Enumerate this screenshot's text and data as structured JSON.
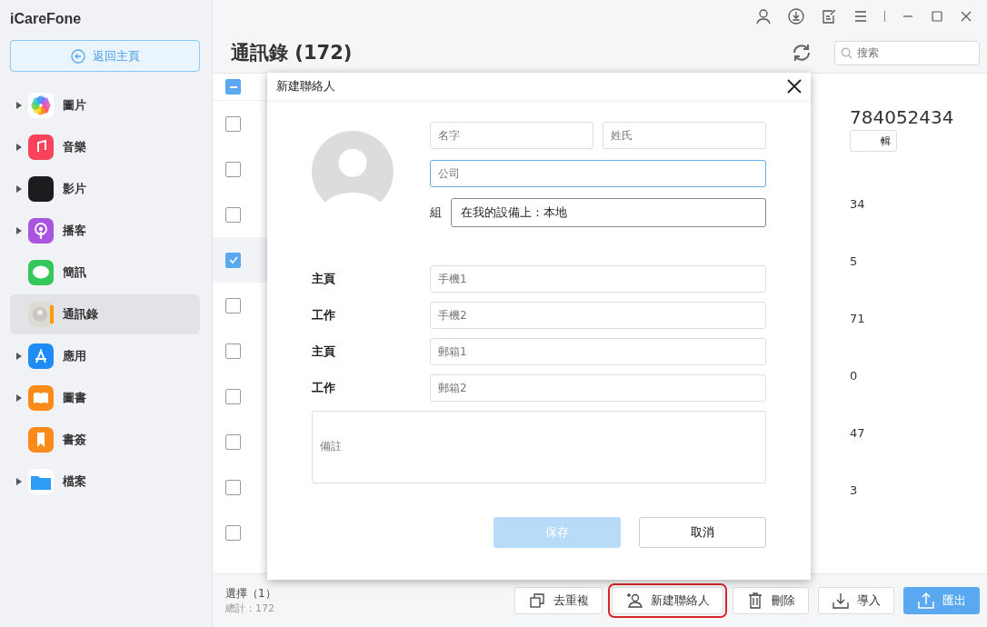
{
  "app": {
    "name": "iCareFone",
    "back_button": "返回主頁"
  },
  "sidebar": {
    "items": [
      {
        "label": "圖片",
        "kind": "photos",
        "expandable": true,
        "selected": false
      },
      {
        "label": "音樂",
        "kind": "music",
        "expandable": true,
        "selected": false
      },
      {
        "label": "影片",
        "kind": "tv",
        "expandable": true,
        "selected": false
      },
      {
        "label": "播客",
        "kind": "podcast",
        "expandable": true,
        "selected": false
      },
      {
        "label": "簡訊",
        "kind": "messages",
        "expandable": false,
        "selected": false
      },
      {
        "label": "通訊錄",
        "kind": "contacts",
        "expandable": false,
        "selected": true
      },
      {
        "label": "應用",
        "kind": "apps",
        "expandable": true,
        "selected": false
      },
      {
        "label": "圖書",
        "kind": "books",
        "expandable": true,
        "selected": false
      },
      {
        "label": "書簽",
        "kind": "bookmarks",
        "expandable": false,
        "selected": false
      },
      {
        "label": "檔案",
        "kind": "files",
        "expandable": true,
        "selected": false
      }
    ]
  },
  "header": {
    "title": "通訊錄 (172)",
    "search": {
      "placeholder": "搜索"
    }
  },
  "list": {
    "select_all_partial": true,
    "rows": [
      {
        "checked": false
      },
      {
        "checked": false
      },
      {
        "checked": false
      },
      {
        "checked": true
      },
      {
        "checked": false
      },
      {
        "checked": false
      },
      {
        "checked": false
      },
      {
        "checked": false
      },
      {
        "checked": false
      },
      {
        "checked": false
      }
    ]
  },
  "detail": {
    "number": "784052434",
    "edit_button": "輯",
    "fragments": [
      "34",
      "5",
      "71",
      "0",
      "47",
      "3"
    ]
  },
  "dialog": {
    "title": "新建聯絡人",
    "first_name": {
      "placeholder": "名字"
    },
    "last_name": {
      "placeholder": "姓氏"
    },
    "company": {
      "placeholder": "公司",
      "focused": true
    },
    "group_label": "組",
    "group_value": "在我的設備上：本地",
    "rows": [
      {
        "label": "主頁",
        "placeholder": "手機1"
      },
      {
        "label": "工作",
        "placeholder": "手機2"
      },
      {
        "label": "主頁",
        "placeholder": "郵箱1"
      },
      {
        "label": "工作",
        "placeholder": "郵箱2"
      }
    ],
    "note": {
      "placeholder": "備註"
    },
    "save_button": {
      "label": "保存",
      "disabled": true
    },
    "cancel_button": "取消"
  },
  "footer": {
    "selected": "選擇（1）",
    "total": "總計：172",
    "buttons": [
      {
        "label": "去重複",
        "kind": "dedupe",
        "highlighted": false,
        "primary": false
      },
      {
        "label": "新建聯絡人",
        "kind": "add-contact",
        "highlighted": true,
        "primary": false
      },
      {
        "label": "刪除",
        "kind": "delete",
        "highlighted": false,
        "primary": false
      },
      {
        "label": "導入",
        "kind": "import",
        "highlighted": false,
        "primary": false
      },
      {
        "label": "匯出",
        "kind": "export",
        "highlighted": false,
        "primary": true
      }
    ]
  }
}
